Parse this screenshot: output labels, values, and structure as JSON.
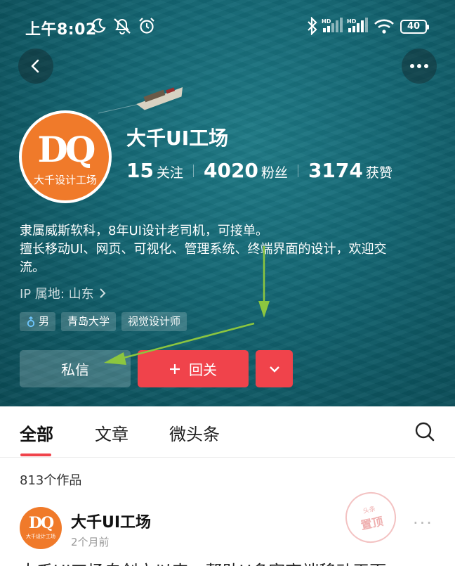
{
  "status_bar": {
    "time": "上午8:02",
    "battery": "40"
  },
  "profile": {
    "name": "大千UI工场",
    "avatar_logo_text": "DQ",
    "avatar_sub_text": "大千设计工场",
    "stats": [
      {
        "value": "15",
        "label": "关注"
      },
      {
        "value": "4020",
        "label": "粉丝"
      },
      {
        "value": "3174",
        "label": "获赞"
      }
    ],
    "bio_lines": [
      "隶属威斯软科，8年UI设计老司机，可接单。",
      "擅长移动UI、网页、可视化、管理系统、终端界面的设计，欢迎交",
      "流。"
    ],
    "ip_location": "IP 属地: 山东",
    "tags": [
      "男",
      "青岛大学",
      "视觉设计师"
    ]
  },
  "actions": {
    "message_label": "私信",
    "follow_back_label": "回关"
  },
  "tabs": [
    "全部",
    "文章",
    "微头条"
  ],
  "works_count": "813个作品",
  "post": {
    "author": "大千UI工场",
    "time": "2个月前",
    "text_preview": "大千UI工场自创立以来，帮助U多家高端移动平面",
    "stamp_top": "头条",
    "stamp_main": "置顶"
  },
  "colors": {
    "accent_red": "#f0434b",
    "avatar_orange": "#f07a2a",
    "hero_teal": "#146774",
    "annotation_green": "#8cc63f"
  }
}
